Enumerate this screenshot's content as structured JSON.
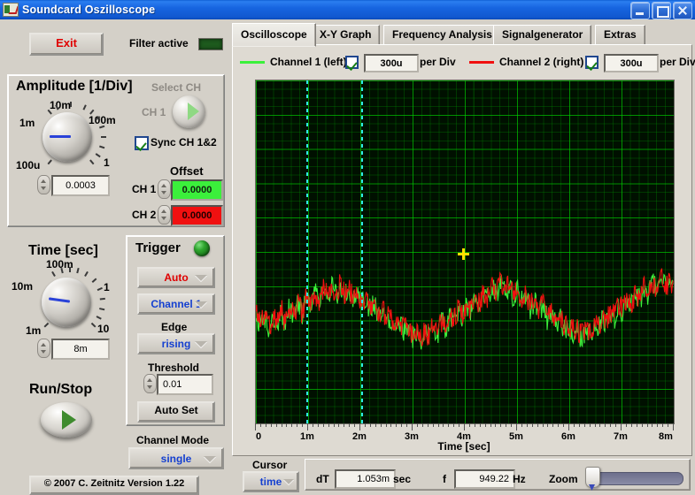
{
  "window": {
    "title": "Soundcard Oszilloscope",
    "icon": "scope-icon",
    "minimize": "minimize-icon",
    "maximize": "maximize-icon",
    "close": "close-icon"
  },
  "toolbar": {
    "exit_label": "Exit",
    "filter_label": "Filter active",
    "filter_led_color": "#1d5a1d"
  },
  "amplitude": {
    "title": "Amplitude [1/Div]",
    "knob_labels": [
      "10m",
      "100m",
      "1m",
      "1",
      "100u"
    ],
    "value": "0.0003",
    "select_ch_label": "Select CH",
    "ch_label": "CH 1",
    "sync_label": "Sync CH 1&2",
    "sync_checked": true,
    "offset_title": "Offset",
    "offset_rows": [
      {
        "name": "CH 1",
        "value": "0.0000",
        "color": "#3bf03b"
      },
      {
        "name": "CH 2",
        "value": "0.0000",
        "color": "#f01010"
      }
    ]
  },
  "time": {
    "title": "Time [sec]",
    "knob_labels": [
      "100m",
      "10m",
      "1",
      "1m",
      "10"
    ],
    "value": "8m"
  },
  "run": {
    "title": "Run/Stop"
  },
  "trigger": {
    "title": "Trigger",
    "led_color": "#1a7a1a",
    "mode": "Auto",
    "mode_color": "#e00000",
    "source": "Channel 1",
    "source_color": "#1540d0",
    "edge_title": "Edge",
    "edge": "rising",
    "edge_color": "#1540d0",
    "threshold_title": "Threshold",
    "threshold": "0.01",
    "autoset_label": "Auto Set"
  },
  "channel_mode": {
    "title": "Channel Mode",
    "value": "single",
    "value_color": "#1540d0"
  },
  "copyright": "© 2007   C. Zeitnitz Version 1.22",
  "tabs": [
    {
      "label": "Oscilloscope",
      "active": true
    },
    {
      "label": "X-Y Graph",
      "active": false
    },
    {
      "label": "Frequency Analysis",
      "active": false
    },
    {
      "label": "Signalgenerator",
      "active": false
    },
    {
      "label": "Extras",
      "active": false
    }
  ],
  "channels": [
    {
      "name": "Channel 1 (left)",
      "color": "#3bf03b",
      "enabled": true,
      "per_div": "300u",
      "per_div_label": "per Div"
    },
    {
      "name": "Channel 2 (right)",
      "color": "#f01010",
      "enabled": true,
      "per_div": "300u",
      "per_div_label": "per Div"
    }
  ],
  "cursor": {
    "title": "Cursor",
    "mode": "time",
    "mode_color": "#1540d0",
    "dt_label": "dT",
    "dt_value": "1.053m",
    "dt_unit": "sec",
    "f_label": "f",
    "f_value": "949.22",
    "f_unit": "Hz",
    "zoom_label": "Zoom",
    "zoom_position": 2
  },
  "chart_data": {
    "type": "line",
    "title": "",
    "xlabel": "Time [sec]",
    "ylabel": "",
    "xlim": [
      0,
      0.008
    ],
    "x_tick_labels": [
      "0",
      "1m",
      "2m",
      "3m",
      "4m",
      "5m",
      "6m",
      "7m",
      "8m"
    ],
    "x_tick_values": [
      0,
      0.001,
      0.002,
      0.003,
      0.004,
      0.005,
      0.006,
      0.007,
      0.008
    ],
    "grid": true,
    "grid_color": "#00d700",
    "background": "#001000",
    "divisions_x": 8,
    "divisions_y": 10,
    "volts_per_div": "300u",
    "legend_position": "top",
    "cursors": {
      "color": "#2fe8e8",
      "style": "dotted-vertical",
      "t1": 0.00097,
      "t2": 0.00202,
      "dT": "1.053m",
      "f": "949.22"
    },
    "marker": {
      "color": "#ffe000",
      "t": 0.00395,
      "label": "cursor-marker"
    },
    "series": [
      {
        "name": "Channel 1 (left)",
        "color": "#3bf03b",
        "description": "Noisy low-frequency waveform, ~1 kHz envelope, centered near -2.0 divisions from top-center, peak-to-peak approx 1.8 divisions",
        "values": [
          -0.18,
          -0.55,
          -0.32,
          -0.72,
          -0.3,
          -0.62,
          -0.2,
          -0.48,
          -0.05,
          -0.38,
          0.1,
          -0.28,
          0.22,
          -0.12,
          0.35,
          0.02,
          0.42,
          0.12,
          0.55,
          0.2,
          0.62,
          0.28,
          0.5,
          0.15,
          0.38,
          0.05,
          0.2,
          -0.1,
          0.05,
          -0.28,
          -0.15,
          -0.45,
          -0.3,
          -0.6,
          -0.42,
          -0.75,
          -0.55,
          -0.88,
          -0.68,
          -0.95,
          -0.72,
          -0.9,
          -0.6,
          -0.78,
          -0.45,
          -0.62,
          -0.3,
          -0.48,
          -0.12,
          -0.32,
          0.02,
          -0.18,
          0.18,
          -0.02,
          0.32,
          0.12,
          0.48,
          0.25,
          0.6,
          0.35,
          0.52,
          0.2,
          0.4,
          0.08,
          0.25,
          -0.08,
          0.1,
          -0.22,
          -0.05,
          -0.38,
          -0.2,
          -0.52,
          -0.35,
          -0.68,
          -0.5,
          -0.8,
          -0.62,
          -0.88,
          -0.7,
          -0.82,
          -0.55,
          -0.68,
          -0.4,
          -0.52,
          -0.22,
          -0.35,
          -0.05,
          -0.18,
          0.12,
          0.0,
          0.28,
          0.15,
          0.45,
          0.28,
          0.58,
          0.38,
          0.7,
          0.45,
          0.6,
          0.3
        ]
      },
      {
        "name": "Channel 2 (right)",
        "color": "#f01010",
        "description": "Noisy waveform similar to Channel 1 with slight phase/amplitude difference, overlaid",
        "values": [
          -0.22,
          -0.6,
          -0.28,
          -0.68,
          -0.35,
          -0.58,
          -0.15,
          -0.52,
          -0.1,
          -0.34,
          0.05,
          -0.32,
          0.18,
          -0.08,
          0.3,
          0.06,
          0.38,
          0.16,
          0.5,
          0.24,
          0.58,
          0.22,
          0.46,
          0.1,
          0.34,
          0.0,
          0.16,
          -0.14,
          0.0,
          -0.32,
          -0.18,
          -0.4,
          -0.34,
          -0.56,
          -0.46,
          -0.7,
          -0.58,
          -0.84,
          -0.72,
          -0.9,
          -0.76,
          -0.86,
          -0.64,
          -0.74,
          -0.48,
          -0.58,
          -0.34,
          -0.44,
          -0.16,
          -0.28,
          -0.02,
          -0.14,
          0.14,
          0.02,
          0.28,
          0.16,
          0.44,
          0.28,
          0.56,
          0.38,
          0.48,
          0.24,
          0.36,
          0.12,
          0.2,
          -0.04,
          0.06,
          -0.26,
          -0.02,
          -0.34,
          -0.24,
          -0.48,
          -0.38,
          -0.64,
          -0.54,
          -0.76,
          -0.66,
          -0.84,
          -0.74,
          -0.78,
          -0.58,
          -0.64,
          -0.44,
          -0.48,
          -0.26,
          -0.3,
          -0.09,
          -0.14,
          0.08,
          0.04,
          0.24,
          0.18,
          0.4,
          0.32,
          0.54,
          0.42,
          0.66,
          0.48,
          0.56,
          0.34
        ]
      }
    ]
  }
}
